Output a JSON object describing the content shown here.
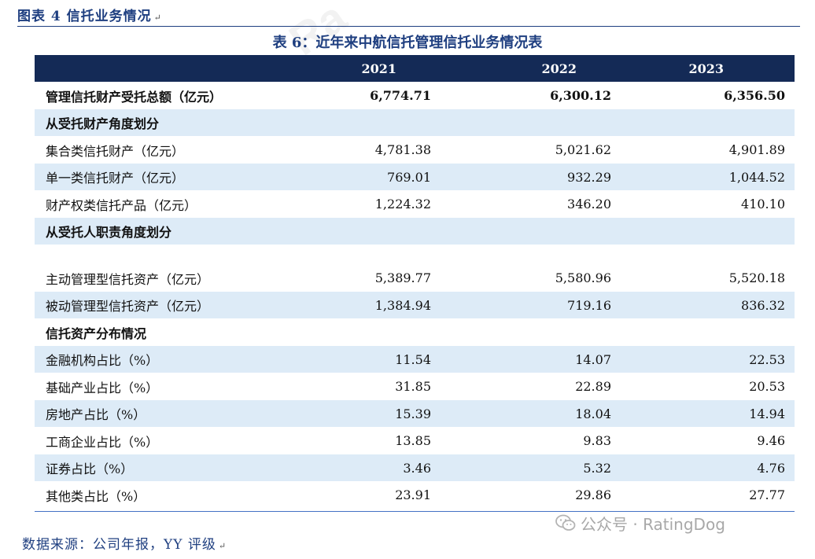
{
  "figure_title": "图表 4 信托业务情况",
  "table_title": "表 6：近年来中航信托管理信托业务情况表",
  "columns": [
    "",
    "2021",
    "2022",
    "2023"
  ],
  "rows": [
    {
      "label": "管理信托财产受托总额（亿元）",
      "v2021": "6,774.71",
      "v2022": "6,300.12",
      "v2023": "6,356.50"
    },
    {
      "label": "从受托财产角度划分",
      "v2021": "",
      "v2022": "",
      "v2023": ""
    },
    {
      "label": "集合类信托财产（亿元）",
      "v2021": "4,781.38",
      "v2022": "5,021.62",
      "v2023": "4,901.89"
    },
    {
      "label": "单一类信托财产（亿元）",
      "v2021": "769.01",
      "v2022": "932.29",
      "v2023": "1,044.52"
    },
    {
      "label": "财产权类信托产品（亿元）",
      "v2021": "1,224.32",
      "v2022": "346.20",
      "v2023": "410.10"
    },
    {
      "label": "从受托人职责角度划分",
      "v2021": "",
      "v2022": "",
      "v2023": ""
    },
    {
      "label": "",
      "v2021": "",
      "v2022": "",
      "v2023": ""
    },
    {
      "label": "主动管理型信托资产（亿元）",
      "v2021": "5,389.77",
      "v2022": "5,580.96",
      "v2023": "5,520.18"
    },
    {
      "label": "被动管理型信托资产（亿元）",
      "v2021": "1,384.94",
      "v2022": "719.16",
      "v2023": "836.32"
    },
    {
      "label": "信托资产分布情况",
      "v2021": "",
      "v2022": "",
      "v2023": ""
    },
    {
      "label": "金融机构占比（%）",
      "v2021": "11.54",
      "v2022": "14.07",
      "v2023": "22.53"
    },
    {
      "label": "基础产业占比（%）",
      "v2021": "31.85",
      "v2022": "22.89",
      "v2023": "20.53"
    },
    {
      "label": "房地产占比（%）",
      "v2021": "15.39",
      "v2022": "18.04",
      "v2023": "14.94"
    },
    {
      "label": "工商企业占比（%）",
      "v2021": "13.85",
      "v2022": "9.83",
      "v2023": "9.46"
    },
    {
      "label": "证券占比（%）",
      "v2021": "3.46",
      "v2022": "5.32",
      "v2023": "4.76"
    },
    {
      "label": "其他类占比（%）",
      "v2021": "23.91",
      "v2022": "29.86",
      "v2023": "27.77"
    }
  ],
  "source": "数据来源：公司年报，YY 评级",
  "watermark": "公众号 · RatingDog",
  "watermark_top": "Ra",
  "paragraph_mark": "↵",
  "colors": {
    "header_bg": "#142a56",
    "shade_bg": "#ddebf7",
    "title_blue": "#1f3f80"
  }
}
